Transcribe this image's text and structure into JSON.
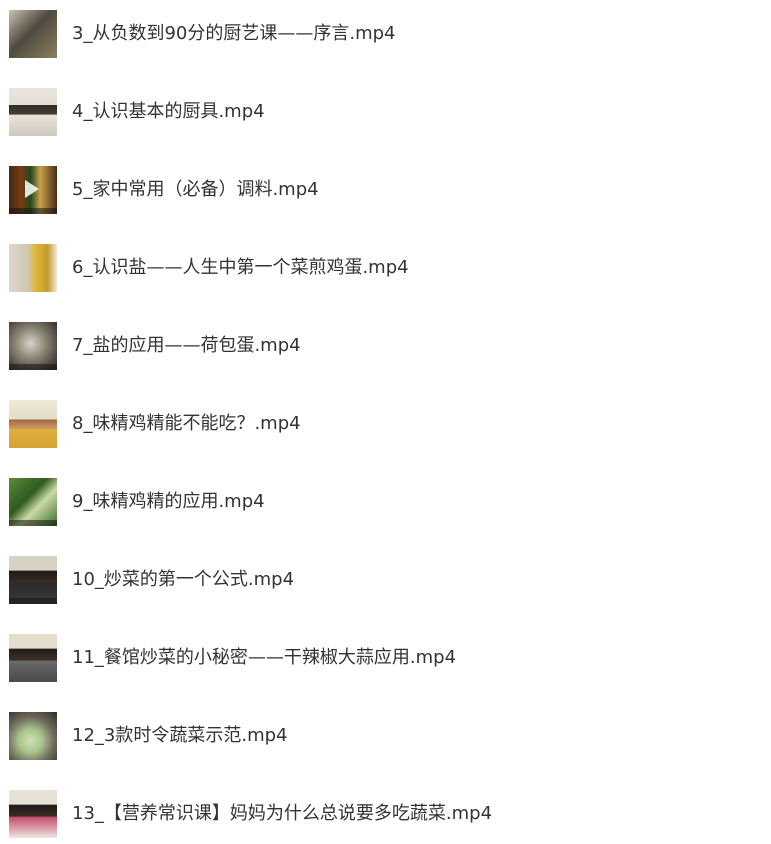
{
  "files": [
    {
      "name": "3_从负数到90分的厨艺课——序言.mp4"
    },
    {
      "name": "4_认识基本的厨具.mp4"
    },
    {
      "name": "5_家中常用（必备）调料.mp4"
    },
    {
      "name": "6_认识盐——人生中第一个菜煎鸡蛋.mp4"
    },
    {
      "name": "7_盐的应用——荷包蛋.mp4"
    },
    {
      "name": "8_味精鸡精能不能吃？.mp4"
    },
    {
      "name": "9_味精鸡精的应用.mp4"
    },
    {
      "name": "10_炒菜的第一个公式.mp4"
    },
    {
      "name": "11_餐馆炒菜的小秘密——干辣椒大蒜应用.mp4"
    },
    {
      "name": "12_3款时令蔬菜示范.mp4"
    },
    {
      "name": "13_【营养常识课】妈妈为什么总说要多吃蔬菜.mp4"
    }
  ]
}
